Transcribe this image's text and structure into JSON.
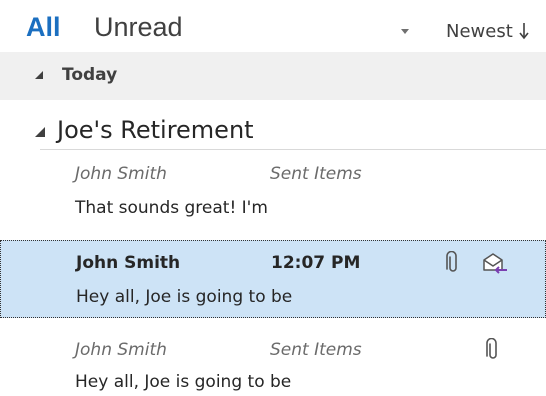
{
  "filter": {
    "all_label": "All",
    "unread_label": "Unread",
    "sort_label": "Newest"
  },
  "group": {
    "today_label": "Today"
  },
  "conversation": {
    "title": "Joe's Retirement"
  },
  "messages": [
    {
      "sender": "John Smith",
      "meta": "Sent Items",
      "preview": "That sounds great! I'm",
      "has_attachment": false,
      "selected": false
    },
    {
      "sender": "John Smith",
      "meta": "12:07 PM",
      "preview": "Hey all,  Joe is going to be",
      "has_attachment": true,
      "icon": "reply-envelope-icon",
      "selected": true
    },
    {
      "sender": "John Smith",
      "meta": "Sent Items",
      "preview": "Hey all,  Joe is going to be",
      "has_attachment": true,
      "selected": false
    }
  ],
  "colors": {
    "accent": "#1b6fc0",
    "selected_bg": "#cde3f6",
    "group_bg": "#f0f0f0",
    "reply_arrow": "#7a3fb0"
  }
}
